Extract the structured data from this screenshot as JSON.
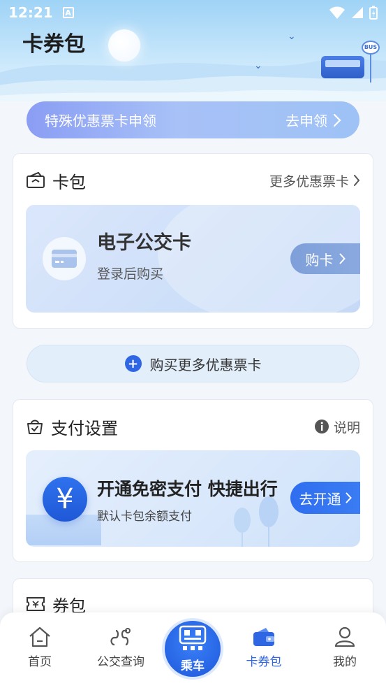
{
  "status_bar": {
    "time": "12:21",
    "notification_glyph": "A"
  },
  "page": {
    "title": "卡券包"
  },
  "scene": {
    "bus_sign": "BUS"
  },
  "promo_banner": {
    "text": "特殊优惠票卡申领",
    "cta": "去申领"
  },
  "card_wallet": {
    "title": "卡包",
    "more_label": "更多优惠票卡",
    "card": {
      "name": "电子公交卡",
      "subtitle": "登录后购买",
      "buy_label": "购卡"
    }
  },
  "buy_more": {
    "label": "购买更多优惠票卡"
  },
  "payment": {
    "title": "支付设置",
    "help_label": "说明",
    "card": {
      "title": "开通免密支付  快捷出行",
      "subtitle": "默认卡包余额支付",
      "open_label": "去开通",
      "symbol": "¥"
    }
  },
  "coupon": {
    "title": "券包"
  },
  "bottom_nav": {
    "items": [
      {
        "label": "首页",
        "icon": "home-icon"
      },
      {
        "label": "公交查询",
        "icon": "route-icon"
      },
      {
        "label": "乘车",
        "icon": "qr-code-icon"
      },
      {
        "label": "卡券包",
        "icon": "wallet-icon"
      },
      {
        "label": "我的",
        "icon": "user-icon"
      }
    ],
    "active": "卡券包"
  },
  "colors": {
    "accent": "#2f66e4",
    "background": "#f3f6fb"
  }
}
